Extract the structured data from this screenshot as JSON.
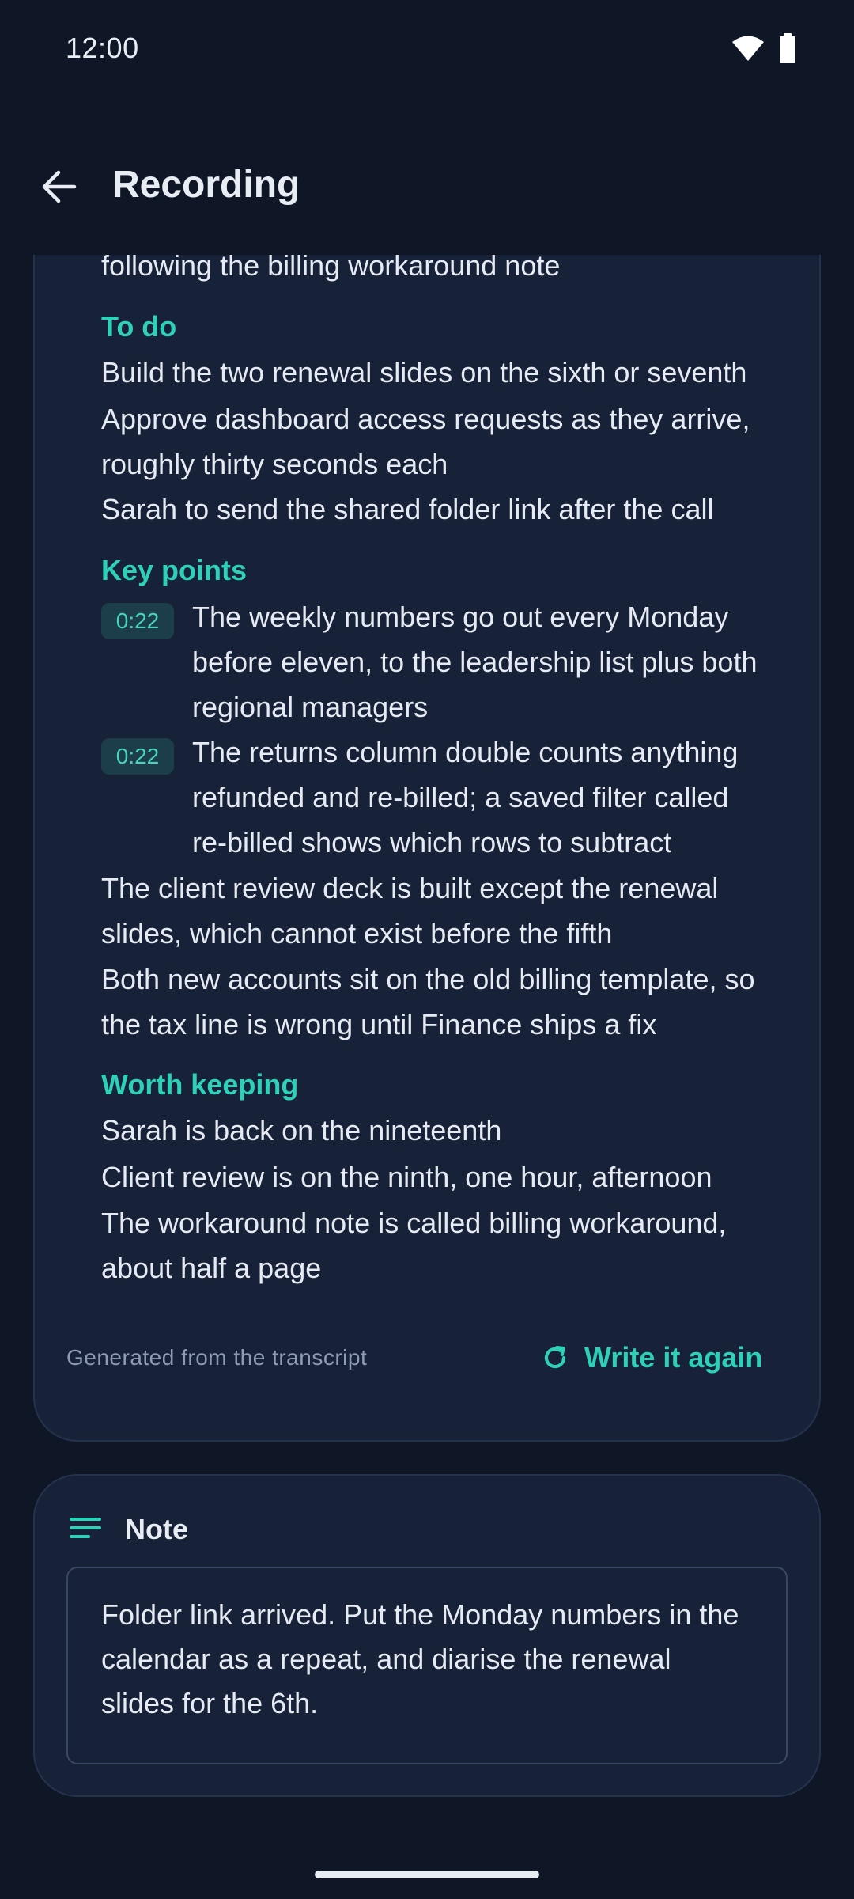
{
  "status": {
    "time": "12:00"
  },
  "header": {
    "title": "Recording"
  },
  "summary": {
    "intro_line": "following the billing workaround note",
    "todo": {
      "heading": "To do",
      "lines": [
        "Build the two renewal slides on the sixth or seventh",
        "Approve dashboard access requests as they arrive,",
        "roughly thirty seconds each",
        "Sarah to send the shared folder link after the call"
      ]
    },
    "key_points": {
      "heading": "Key points",
      "timestamped": [
        {
          "time": "0:22",
          "lines": [
            "The weekly numbers go out every Monday",
            "before eleven, to the leadership list plus both",
            "regional managers"
          ]
        },
        {
          "time": "0:22",
          "lines": [
            "The returns column double counts anything",
            "refunded and re-billed; a saved filter called",
            "re-billed shows which rows to subtract"
          ]
        }
      ],
      "lines": [
        "The client review deck is built except the renewal",
        "slides, which cannot exist before the fifth",
        "Both new accounts sit on the old billing template, so",
        "the tax line is wrong until Finance ships a fix"
      ]
    },
    "worth_keeping": {
      "heading": "Worth keeping",
      "lines": [
        "Sarah is back on the nineteenth",
        "Client review is on the ninth, one hour, afternoon",
        "The workaround note is called billing workaround,",
        "about half a page"
      ]
    },
    "footer_label": "Generated from the transcript",
    "rewrite_label": "Write it again"
  },
  "note": {
    "title": "Note",
    "lines": [
      "Folder link arrived. Put the Monday numbers in the",
      "calendar as a repeat, and diarise the renewal",
      "slides for the 6th."
    ]
  },
  "colors": {
    "background": "#0f1727",
    "card": "#172239",
    "accent": "#2fd0b8",
    "text": "#e6eaf2",
    "muted": "#8f9bb0"
  },
  "icons": [
    "wifi-icon",
    "battery-icon",
    "back-arrow-icon",
    "refresh-icon",
    "notes-lines-icon"
  ]
}
